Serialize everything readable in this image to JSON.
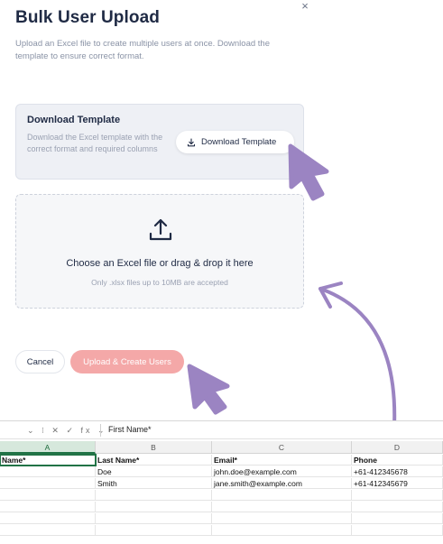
{
  "modal": {
    "title": "Bulk User Upload",
    "close_label": "×",
    "description": "Upload an Excel file to create multiple users at once. Download the template to ensure correct format."
  },
  "template_card": {
    "title": "Download Template",
    "description": "Download the Excel template with the correct format and required columns",
    "button_label": "Download Template",
    "button_icon": "download-icon"
  },
  "dropzone": {
    "icon": "upload-icon",
    "title": "Choose an Excel file or drag & drop it here",
    "subtitle": "Only .xlsx files up to 10MB are accepted"
  },
  "footer": {
    "cancel_label": "Cancel",
    "submit_label": "Upload & Create Users"
  },
  "spreadsheet": {
    "formula_controls": "⌄ ⁝ ✕ ✓ fx ⌄",
    "formula_value": "First Name*",
    "columns": [
      "A",
      "B",
      "C",
      "D"
    ],
    "headers": [
      "Name*",
      "Last Name*",
      "Email*",
      "Phone"
    ],
    "rows": [
      [
        "",
        "Doe",
        "john.doe@example.com",
        "+61-412345678"
      ],
      [
        "",
        "Smith",
        "jane.smith@example.com",
        "+61-412345679"
      ]
    ]
  },
  "colors": {
    "title_text": "#1f2a44",
    "muted_text": "#8a93a6",
    "submit_disabled": "#f4a8a8",
    "annotation_purple": "#9b84c2",
    "excel_green": "#217346"
  }
}
